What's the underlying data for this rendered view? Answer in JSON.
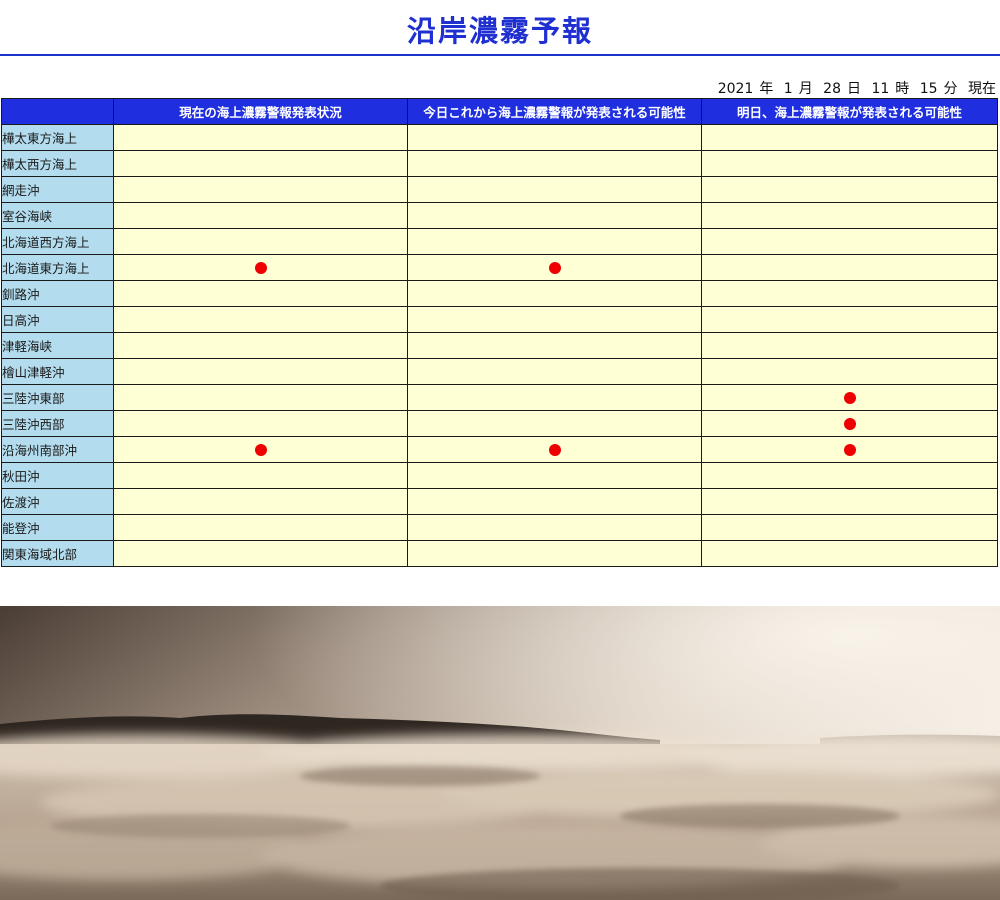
{
  "page": {
    "title": "沿岸濃霧予報"
  },
  "timestamp": {
    "year": "2021",
    "year_unit": "年",
    "month": "1",
    "month_unit": "月",
    "day": "28",
    "day_unit": "日",
    "hour": "11",
    "hour_unit": "時",
    "minute": "15",
    "minute_unit": "分",
    "suffix": "現在"
  },
  "table": {
    "headers": [
      "現在の海上濃霧警報発表状況",
      "今日これから海上濃霧警報が発表される可能性",
      "明日、海上濃霧警報が発表される可能性"
    ],
    "rows": [
      {
        "area": "樺太東方海上",
        "marks": [
          false,
          false,
          false
        ]
      },
      {
        "area": "樺太西方海上",
        "marks": [
          false,
          false,
          false
        ]
      },
      {
        "area": "網走沖",
        "marks": [
          false,
          false,
          false
        ]
      },
      {
        "area": "室谷海峡",
        "marks": [
          false,
          false,
          false
        ]
      },
      {
        "area": "北海道西方海上",
        "marks": [
          false,
          false,
          false
        ]
      },
      {
        "area": "北海道東方海上",
        "marks": [
          true,
          true,
          false
        ]
      },
      {
        "area": "釧路沖",
        "marks": [
          false,
          false,
          false
        ]
      },
      {
        "area": "日高沖",
        "marks": [
          false,
          false,
          false
        ]
      },
      {
        "area": "津軽海峡",
        "marks": [
          false,
          false,
          false
        ]
      },
      {
        "area": "檜山津軽沖",
        "marks": [
          false,
          false,
          false
        ]
      },
      {
        "area": "三陸沖東部",
        "marks": [
          false,
          false,
          true
        ]
      },
      {
        "area": "三陸沖西部",
        "marks": [
          false,
          false,
          true
        ]
      },
      {
        "area": "沿海州南部沖",
        "marks": [
          true,
          true,
          true
        ]
      },
      {
        "area": "秋田沖",
        "marks": [
          false,
          false,
          false
        ]
      },
      {
        "area": "佐渡沖",
        "marks": [
          false,
          false,
          false
        ]
      },
      {
        "area": "能登沖",
        "marks": [
          false,
          false,
          false
        ]
      },
      {
        "area": "関東海域北部",
        "marks": [
          false,
          false,
          false
        ]
      }
    ],
    "mark_color": "#ee0000"
  },
  "colors": {
    "header_bg": "#1f2fe0",
    "area_bg": "#b3dcee",
    "cell_bg": "#ffffd6",
    "title_color": "#1f2fd0"
  }
}
